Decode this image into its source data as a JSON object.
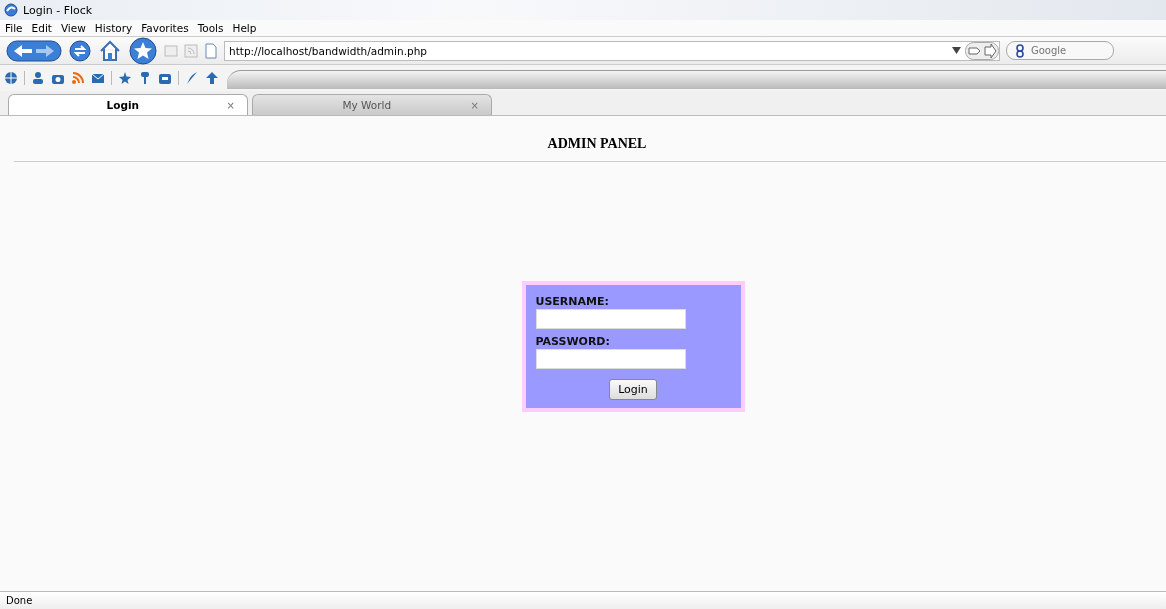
{
  "window": {
    "title": "Login - Flock"
  },
  "menu": [
    "File",
    "Edit",
    "View",
    "History",
    "Favorites",
    "Tools",
    "Help"
  ],
  "toolbar": {
    "address": "http://localhost/bandwidth/admin.php",
    "search_placeholder": "Google"
  },
  "tabs": [
    {
      "label": "Login",
      "close": "×",
      "selected": true
    },
    {
      "label": "My World",
      "close": "×",
      "selected": false
    }
  ],
  "page": {
    "heading": "ADMIN PANEL"
  },
  "form": {
    "fields": [
      {
        "label": "USERNAME:"
      },
      {
        "label": "PASSWORD:"
      }
    ],
    "button": "Login"
  },
  "status_bar": "Done"
}
